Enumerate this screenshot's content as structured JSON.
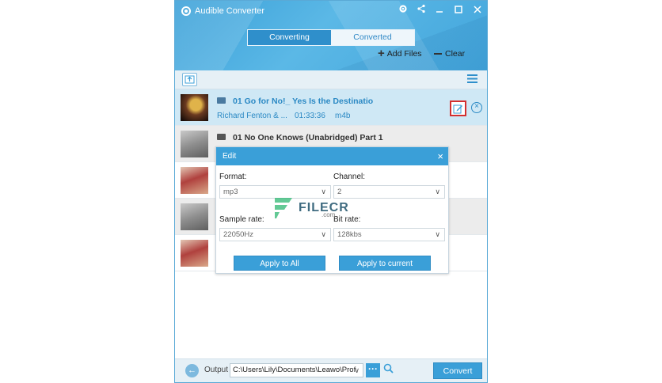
{
  "app": {
    "title": "Audible Converter"
  },
  "tabs": [
    {
      "label": "Converting",
      "active": true
    },
    {
      "label": "Converted",
      "active": false
    }
  ],
  "header_actions": {
    "add_files": "Add Files",
    "clear": "Clear"
  },
  "files": [
    {
      "title": "01 Go for No!_ Yes Is the Destinatio",
      "author": "Richard Fenton & ...",
      "duration": "01:33:36",
      "format": "m4b",
      "selected": true
    },
    {
      "title": "01 No One Knows (Unabridged) Part 1"
    }
  ],
  "edit_dialog": {
    "title": "Edit",
    "format_label": "Format:",
    "format_value": "mp3",
    "channel_label": "Channel:",
    "channel_value": "2",
    "sample_rate_label": "Sample rate:",
    "sample_rate_value": "22050Hz",
    "bit_rate_label": "Bit rate:",
    "bit_rate_value": "128kbs",
    "apply_all": "Apply to All",
    "apply_current": "Apply to current"
  },
  "watermark": {
    "text": "FILECR",
    "sub": ".com"
  },
  "footer": {
    "output_label": "Output",
    "output_path": "C:\\Users\\Lily\\Documents\\Leawo\\Prof",
    "convert": "Convert"
  },
  "colors": {
    "accent": "#3a9fd8",
    "highlight": "#d32f2f"
  }
}
